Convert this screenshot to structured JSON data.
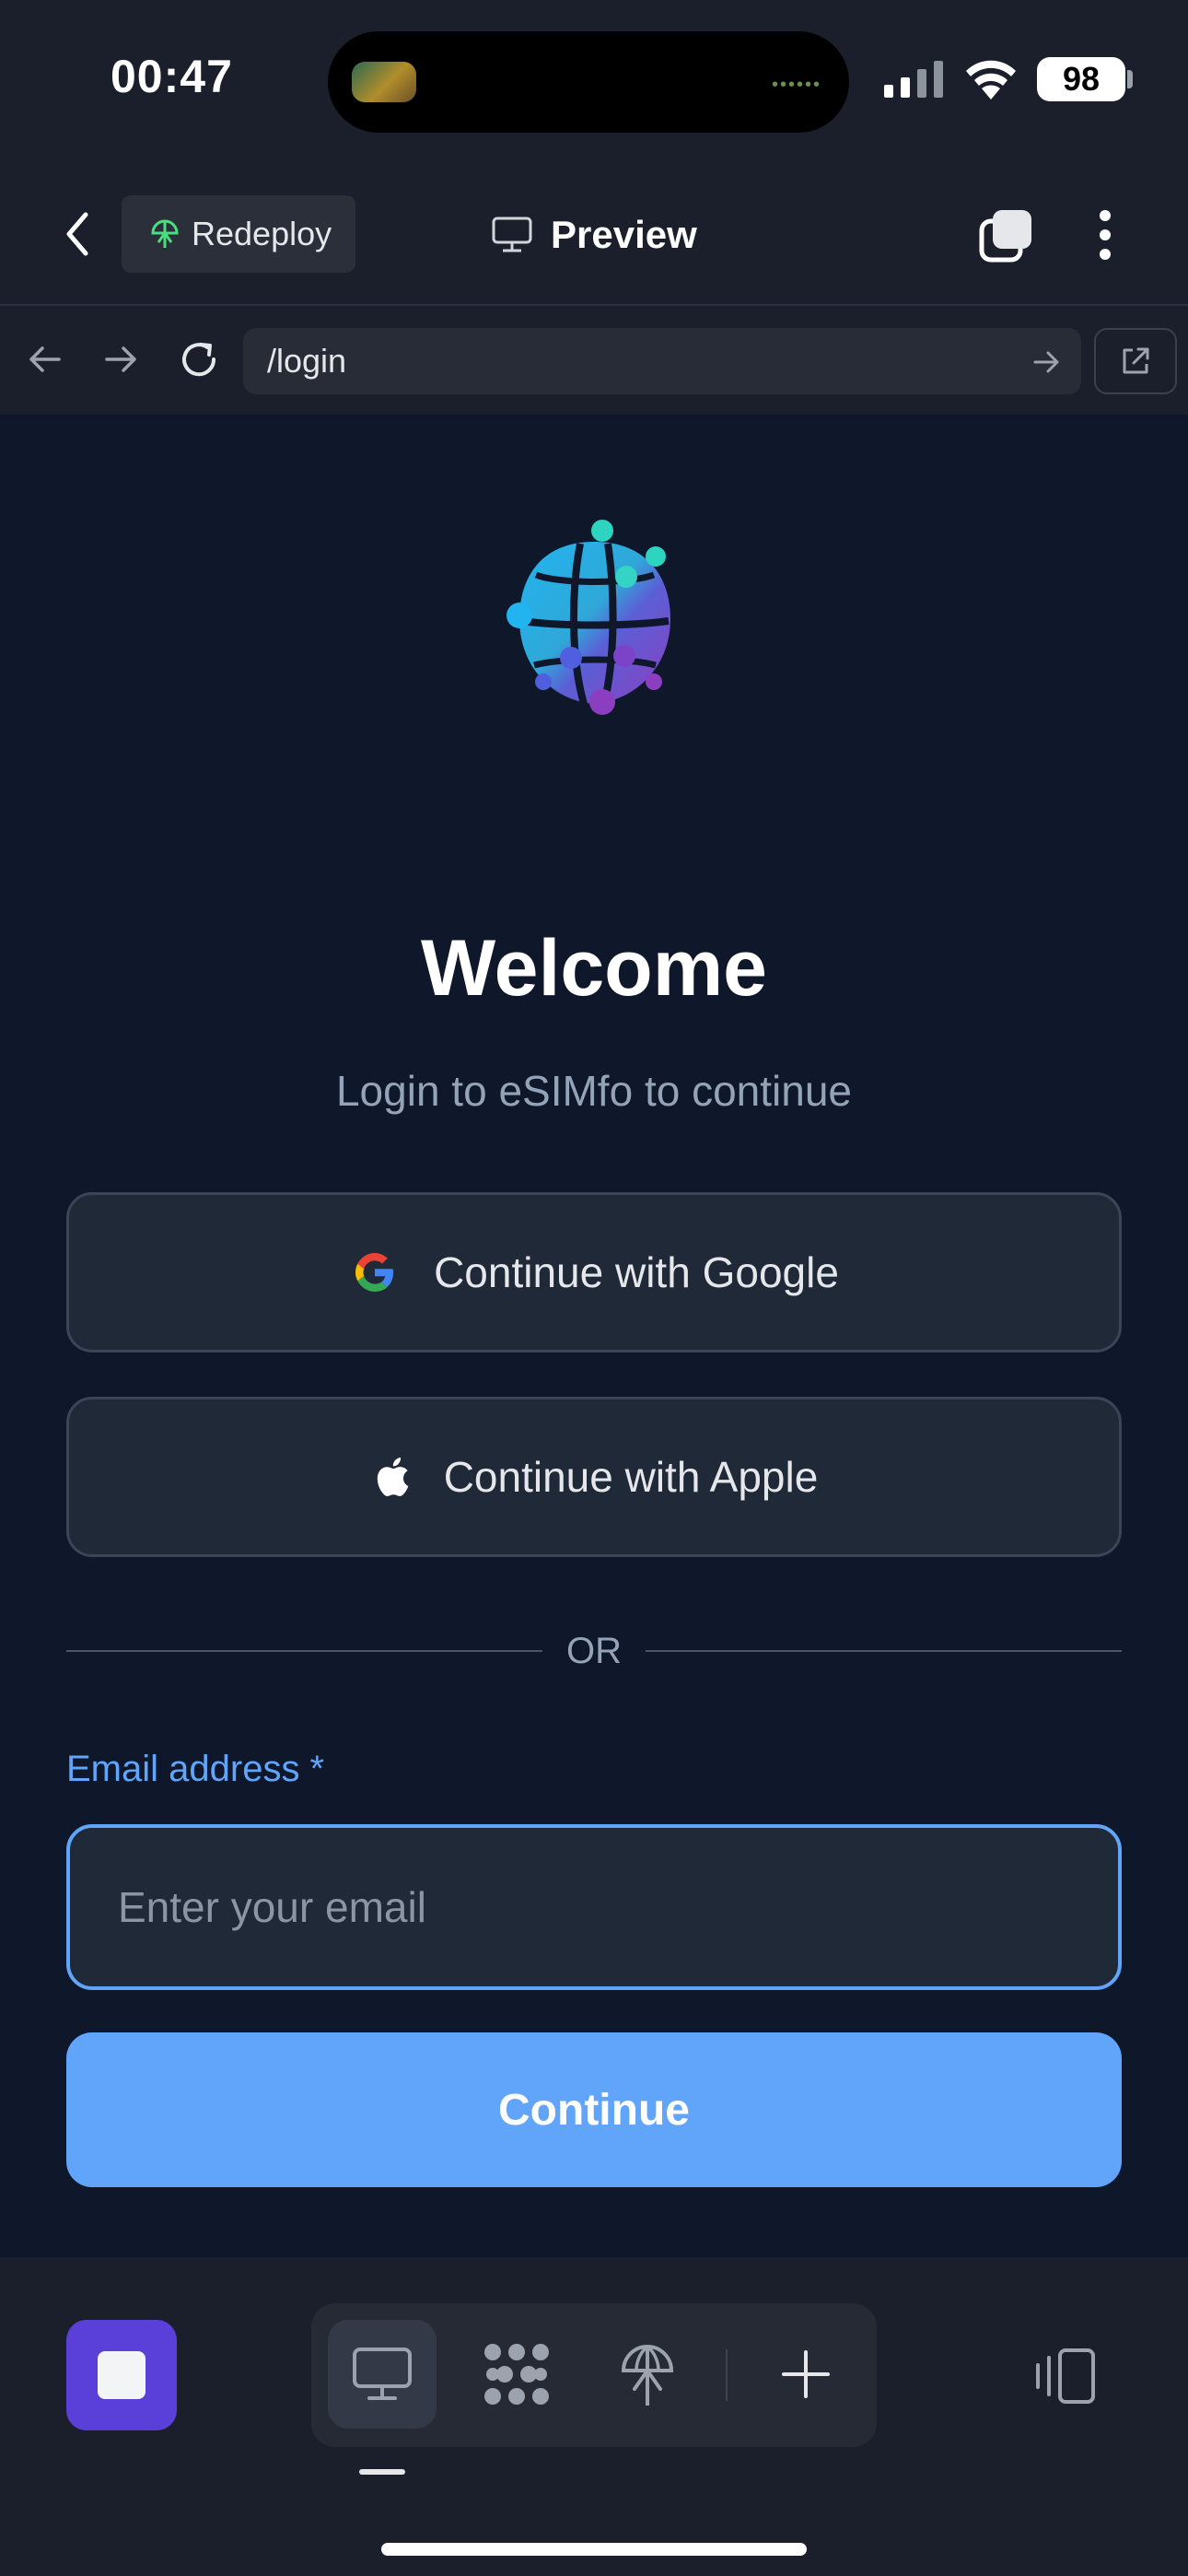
{
  "status_bar": {
    "time": "00:47",
    "battery": "98"
  },
  "nav": {
    "redeploy_label": "Redeploy",
    "title": "Preview"
  },
  "browser": {
    "url": "/login"
  },
  "login": {
    "title": "Welcome",
    "subtitle": "Login to eSIMfo to continue",
    "google_label": "Continue with Google",
    "apple_label": "Continue with Apple",
    "divider": "OR",
    "email_label": "Email address *",
    "email_placeholder": "Enter your email",
    "email_value": "",
    "continue_label": "Continue"
  },
  "colors": {
    "background": "#0f172a",
    "accent": "#60a5fa",
    "stop_button": "#5b3fd9"
  },
  "icons": [
    "chevron-left-icon",
    "globe-icon",
    "monitor-icon",
    "tabs-icon",
    "more-icon",
    "arrow-left-icon",
    "arrow-right-icon",
    "refresh-icon",
    "external-link-icon",
    "google-icon",
    "apple-icon",
    "stop-icon",
    "dots-icon",
    "plus-icon",
    "device-rotate-icon"
  ]
}
